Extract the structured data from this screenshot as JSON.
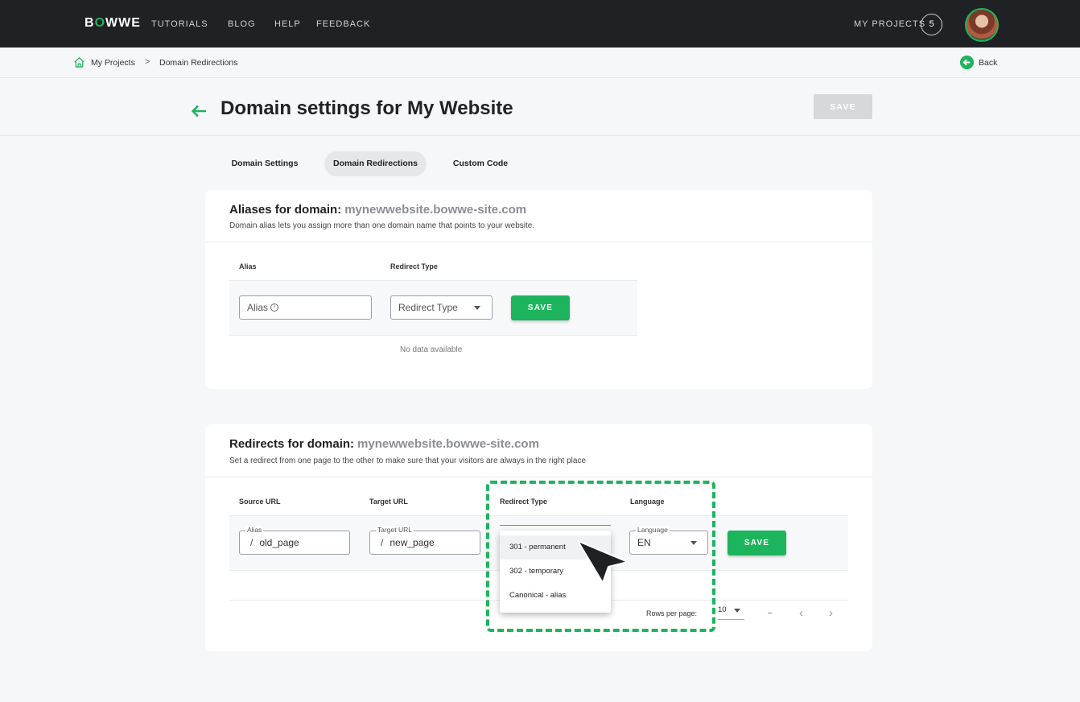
{
  "nav": {
    "logo_left": "B",
    "logo_o": "O",
    "logo_right": "WWE",
    "links": [
      "TUTORIALS",
      "BLOG",
      "HELP",
      "FEEDBACK"
    ],
    "my_projects_label": "MY PROJECTS",
    "project_count": "5"
  },
  "breadcrumb": {
    "home": "My Projects",
    "separator": ">",
    "current": "Domain Redirections",
    "back": "Back"
  },
  "header": {
    "title": "Domain settings for My Website",
    "save_label": "SAVE"
  },
  "tabs": [
    {
      "label": "Domain Settings",
      "active": false
    },
    {
      "label": "Domain Redirections",
      "active": true
    },
    {
      "label": "Custom Code",
      "active": false
    }
  ],
  "aliases": {
    "title": "Aliases for domain:",
    "domain": "mynewwebsite.bowwe-site.com",
    "subtitle": "Domain alias lets you assign more than one domain name that points to your website.",
    "col_alias": "Alias",
    "col_redirect": "Redirect Type",
    "alias_placeholder": "Alias",
    "redirect_placeholder": "Redirect Type",
    "save_label": "SAVE",
    "empty": "No data available"
  },
  "redirects": {
    "title": "Redirects for domain:",
    "domain": "mynewwebsite.bowwe-site.com",
    "subtitle": "Set a redirect from one page to the other to make sure that your visitors are always in the right place",
    "col_source": "Source URL",
    "col_target": "Target URL",
    "col_redirect": "Redirect Type",
    "col_language": "Language",
    "source_legend": "Alias",
    "source_slash": "/",
    "source_value": "old_page",
    "target_legend": "Target URL",
    "target_slash": "/",
    "target_value": "new_page",
    "redirect_legend": "Redirect Type",
    "language_legend": "Language",
    "language_value": "EN",
    "save_label": "SAVE",
    "dropdown_options": [
      "301 - permanent",
      "302 - temporary",
      "Canonical - alias"
    ],
    "rows_per_page_label": "Rows per page:",
    "rows_per_page_value": "10",
    "range_text": "–",
    "prev": "‹",
    "next": "›"
  },
  "colors": {
    "accent": "#1db45e",
    "nav_bg": "#1f2124"
  }
}
